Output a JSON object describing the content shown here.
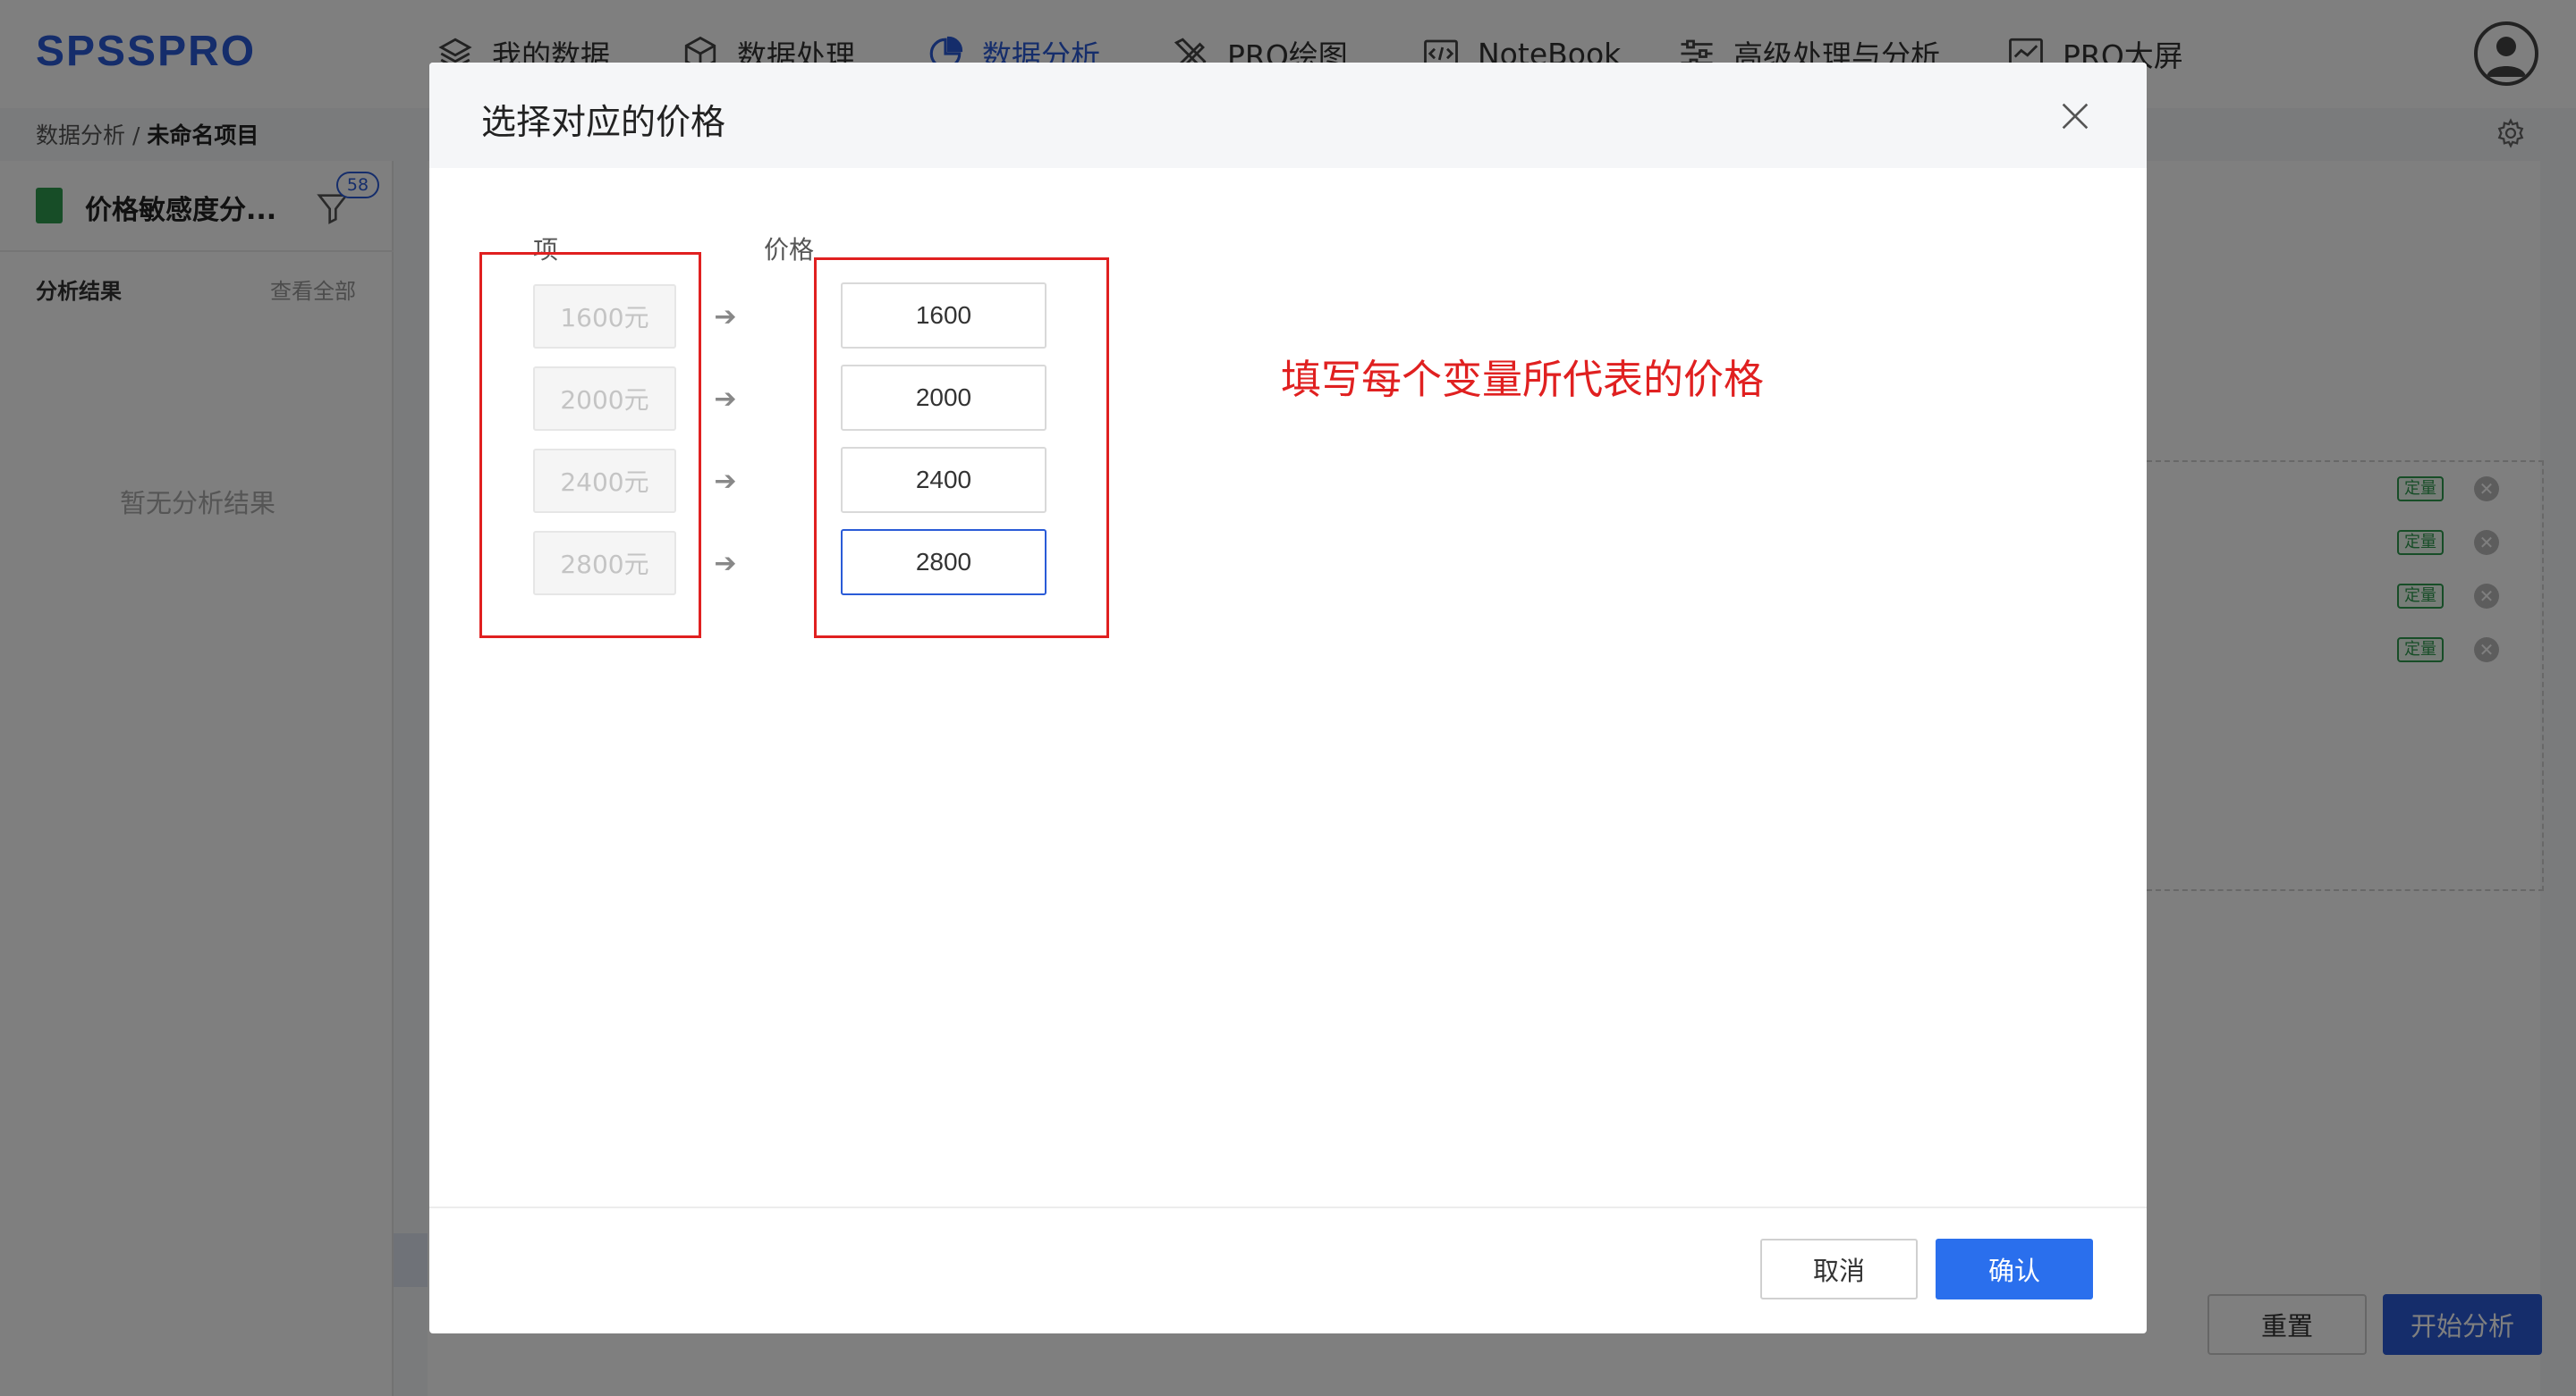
{
  "app": {
    "logo": "SPSSPRO"
  },
  "nav": [
    {
      "label": "我的数据",
      "icon": "layers-icon"
    },
    {
      "label": "数据处理",
      "icon": "box-icon"
    },
    {
      "label": "数据分析",
      "icon": "pie-chart-icon",
      "active": true
    },
    {
      "label": "PRO绘图",
      "icon": "pencil-ruler-icon"
    },
    {
      "label": "NoteBook",
      "icon": "code-icon"
    },
    {
      "label": "高级处理与分析",
      "icon": "sliders-icon"
    },
    {
      "label": "PRO大屏",
      "icon": "monitor-chart-icon"
    }
  ],
  "breadcrumb": {
    "parent": "数据分析",
    "separator": "/",
    "current": "未命名项目"
  },
  "left_panel": {
    "method_title": "价格敏感度分...",
    "filter_badge": "58",
    "results_title": "分析结果",
    "view_all": "查看全部",
    "empty_text": "暂无分析结果"
  },
  "variables_panel": {
    "tag_label": "定量",
    "remove_symbol": "✕",
    "row_count": 4
  },
  "background_buttons": {
    "reset": "重置",
    "start": "开始分析"
  },
  "modal": {
    "title": "选择对应的价格",
    "col_item": "项",
    "col_price": "价格",
    "arrow_symbol": "➔",
    "rows": [
      {
        "item": "1600元",
        "price": "1600"
      },
      {
        "item": "2000元",
        "price": "2000"
      },
      {
        "item": "2400元",
        "price": "2400"
      },
      {
        "item": "2800元",
        "price": "2800"
      }
    ],
    "annotation": "填写每个变量所代表的价格",
    "cancel": "取消",
    "confirm": "确认"
  },
  "colors": {
    "accent": "#2a5bd7",
    "annotation_red": "#e02020",
    "tag_green": "#2e9b4e"
  }
}
